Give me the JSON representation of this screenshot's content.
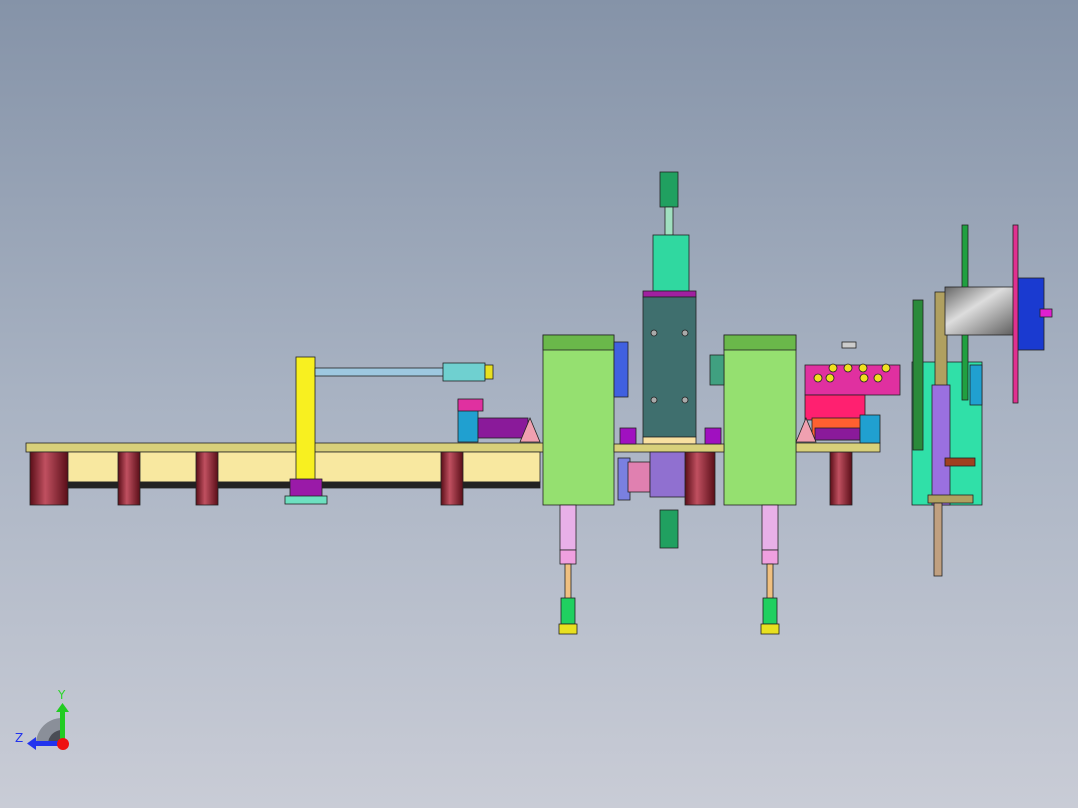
{
  "triad": {
    "y_label": "Y",
    "z_label": "Z"
  },
  "colors": {
    "frame": "#f5e69a",
    "block": "#92e06b",
    "post": "#8b1a2a",
    "column": "#3e6b6b",
    "cyan": "#22d9a0",
    "magenta": "#e0199b"
  }
}
